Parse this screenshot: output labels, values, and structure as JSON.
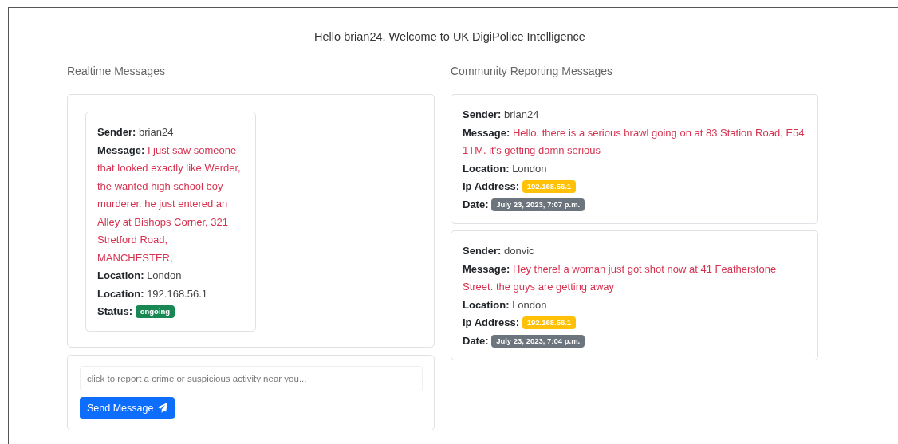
{
  "heading": "Hello brian24, Welcome to UK DigiPolice Intelligence",
  "realtime": {
    "title": "Realtime Messages",
    "messages": [
      {
        "fields": [
          {
            "label": "Sender:",
            "value": "brian24",
            "kind": "plain"
          },
          {
            "label": "Message:",
            "value": "I just saw someone that looked exactly like Werder, the wanted high school boy murderer. he just entered an Alley at Bishops Corner, 321 Stretford Road, MANCHESTER,",
            "kind": "message"
          },
          {
            "label": "Location:",
            "value": "London",
            "kind": "plain"
          },
          {
            "label": "Location:",
            "value": "192.168.56.1",
            "kind": "plain"
          },
          {
            "label": "Status:",
            "value": "ongoing",
            "kind": "badge",
            "color": "#198754"
          }
        ]
      }
    ]
  },
  "form": {
    "placeholder": "click to report a crime or suspicious activity near you...",
    "button": "Send Message"
  },
  "community": {
    "title": "Community Reporting Messages",
    "messages": [
      {
        "fields": [
          {
            "label": "Sender:",
            "value": "brian24",
            "kind": "plain"
          },
          {
            "label": "Message:",
            "value": "Hello, there is a serious brawl going on at 83 Station Road, E54 1TM. it's getting damn serious",
            "kind": "message"
          },
          {
            "label": "Location:",
            "value": "London",
            "kind": "plain"
          },
          {
            "label": "Ip Address:",
            "value": "192.168.56.1",
            "kind": "badge",
            "color": "#ffc107"
          },
          {
            "label": "Date:",
            "value": "July 23, 2023, 7:07 p.m.",
            "kind": "badge",
            "color": "#6c757d"
          }
        ]
      },
      {
        "fields": [
          {
            "label": "Sender:",
            "value": "donvic",
            "kind": "plain"
          },
          {
            "label": "Message:",
            "value": "Hey there! a woman just got shot now at 41 Featherstone Street. the guys are getting away",
            "kind": "message"
          },
          {
            "label": "Location:",
            "value": "London",
            "kind": "plain"
          },
          {
            "label": "Ip Address:",
            "value": "192.168.56.1",
            "kind": "badge",
            "color": "#ffc107"
          },
          {
            "label": "Date:",
            "value": "July 23, 2023, 7:04 p.m.",
            "kind": "badge",
            "color": "#6c757d"
          }
        ]
      }
    ]
  }
}
